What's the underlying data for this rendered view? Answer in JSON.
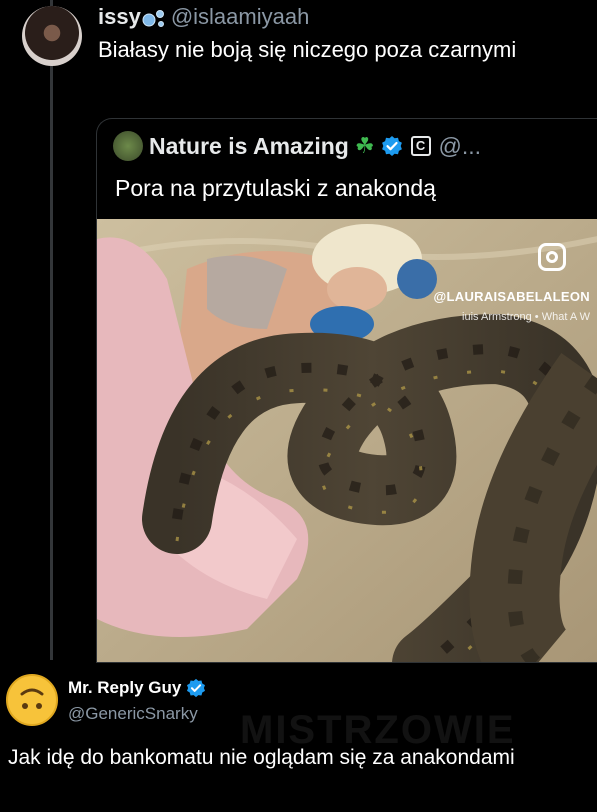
{
  "tweet": {
    "author_name": "issy",
    "author_handle": "@islaamiyaah",
    "text": "Białasy nie boją się niczego poza czarnymi"
  },
  "quote": {
    "author_name": "Nature is Amazing",
    "author_handle": "@...",
    "badge_letter": "C",
    "text": "Pora na przytulaski z anakondą",
    "media_watermark_user": "@LAURAISABELALEON",
    "media_watermark_credit": "iuis Armstrong • What A W"
  },
  "reply": {
    "author_name": "Mr. Reply Guy",
    "author_handle": "@GenericSnarky",
    "text": "Jak idę do bankomatu nie oglądam się za anakondami",
    "site_watermark": "MISTRZOWIE"
  },
  "colors": {
    "background": "#000000",
    "verified": "#1d9bf0",
    "muted": "#8b98a5"
  }
}
